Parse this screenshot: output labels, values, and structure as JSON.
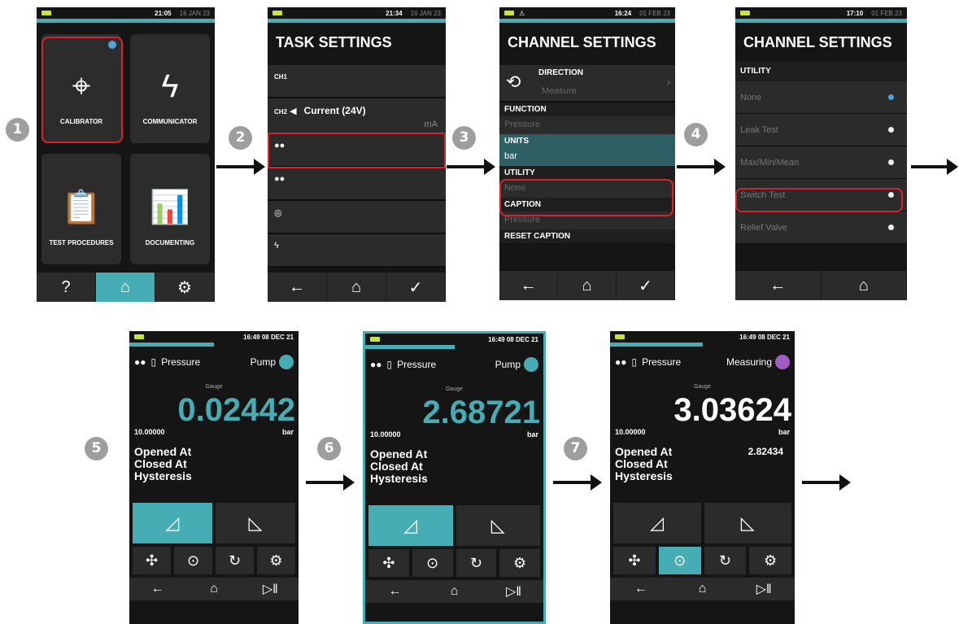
{
  "steps": [
    "1",
    "2",
    "3",
    "4",
    "5",
    "6",
    "7"
  ],
  "s1": {
    "time": "21:05",
    "date": "16 JAN 23",
    "tiles": [
      "CALIBRATOR",
      "COMMUNICATOR",
      "TEST PROCEDURES",
      "DOCUMENTING"
    ]
  },
  "s2": {
    "time": "21:34",
    "date": "16 JAN 23",
    "title": "TASK SETTINGS",
    "ch1": "CH1",
    "ch2": "CH2",
    "ch2_value": "Current (24V)",
    "ch2_unit": "mA"
  },
  "s3": {
    "time": "16:24",
    "date": "01 FEB 23",
    "title": "CHANNEL SETTINGS",
    "direction": "DIRECTION",
    "direction_val": "Measure",
    "function": "FUNCTION",
    "function_val": "Pressure",
    "units": "UNITS",
    "units_val": "bar",
    "utility": "UTILITY",
    "utility_val": "None",
    "caption": "CAPTION",
    "caption_val": "Pressure",
    "reset": "RESET CAPTION"
  },
  "s4": {
    "time": "17:10",
    "date": "01 FEB 23",
    "title": "CHANNEL SETTINGS",
    "section": "UTILITY",
    "options": [
      "None",
      "Leak Test",
      "Max/Min/Mean",
      "Switch Test",
      "Relief Valve"
    ]
  },
  "m": [
    {
      "time": "16:49 08 DEC 21",
      "label": "Pressure",
      "status": "Pump",
      "gauge": "Gauge",
      "value": "0.02442",
      "range": "10.00000",
      "unit": "bar",
      "r1": "Opened At",
      "r2": "Closed At",
      "r3": "Hysteresis",
      "opened_val": ""
    },
    {
      "time": "16:49 08 DEC 21",
      "label": "Pressure",
      "status": "Pump",
      "gauge": "Gauge",
      "value": "2.68721",
      "range": "10.00000",
      "unit": "bar",
      "r1": "Opened At",
      "r2": "Closed At",
      "r3": "Hysteresis",
      "opened_val": ""
    },
    {
      "time": "16:49 08 DEC 21",
      "label": "Pressure",
      "status": "Measuring",
      "gauge": "Gauge",
      "value": "3.03624",
      "range": "10.00000",
      "unit": "bar",
      "r1": "Opened At",
      "r2": "Closed At",
      "r3": "Hysteresis",
      "opened_val": "2.82434"
    }
  ]
}
